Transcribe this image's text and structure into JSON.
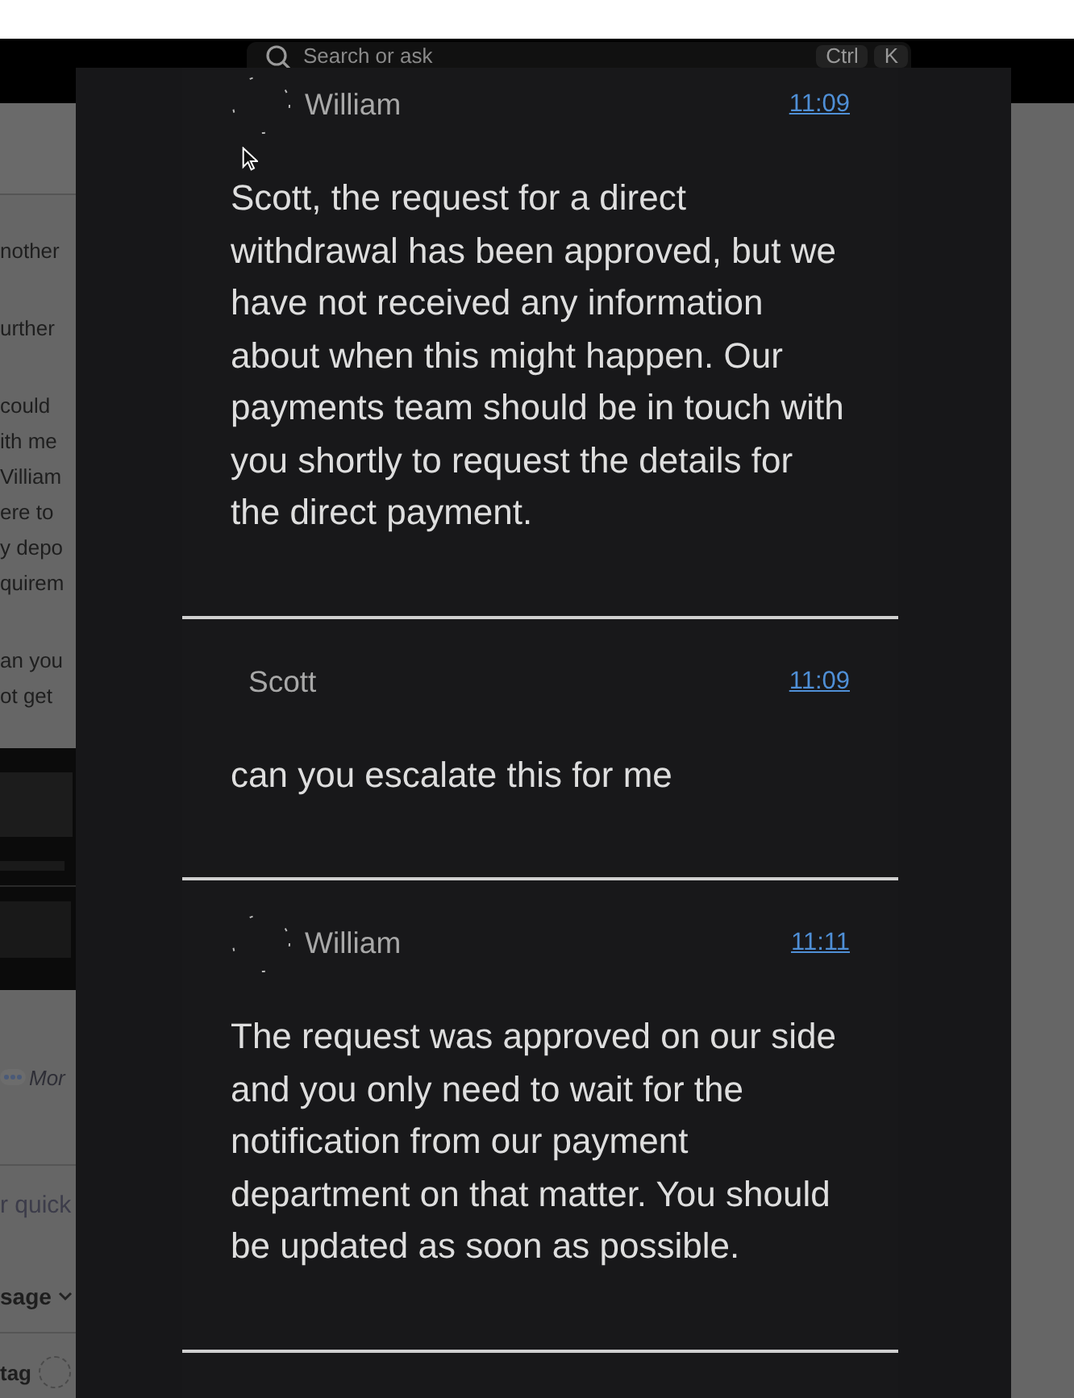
{
  "top_bar": {
    "search": {
      "placeholder": "Search or ask"
    },
    "shortcut_keys": [
      "Ctrl",
      "K"
    ]
  },
  "background_page": {
    "lines": [
      {
        "kind": "text",
        "text": "nother"
      },
      {
        "kind": "text",
        "text": "urther"
      },
      {
        "kind": "text",
        "text": "could"
      },
      {
        "kind": "text",
        "text": "ith me"
      },
      {
        "kind": "text",
        "text": "Villiam"
      },
      {
        "kind": "text",
        "text": "ere to"
      },
      {
        "kind": "text",
        "text": "y depo"
      },
      {
        "kind": "text",
        "text": "quirem"
      },
      {
        "kind": "text",
        "text": "an you"
      },
      {
        "kind": "text",
        "text": "ot get"
      },
      {
        "kind": "picture"
      },
      {
        "kind": "more",
        "text": "Mor"
      },
      {
        "kind": "hint",
        "text": "r quick"
      },
      {
        "kind": "dropdown",
        "text": "sage"
      },
      {
        "kind": "label",
        "text": "tag"
      }
    ]
  },
  "conversation": {
    "messages": [
      {
        "author": "William",
        "has_avatar": true,
        "time": "11:09",
        "text": "Scott, the request for a direct withdrawal has been approved, but we have not received any information about when this might happen. Our payments team should be in touch with you shortly to request the details for the direct payment."
      },
      {
        "author": "Scott",
        "has_avatar": false,
        "time": "11:09",
        "text": "can you escalate this for me"
      },
      {
        "author": "William",
        "has_avatar": true,
        "time": "11:11",
        "text": "The request was approved on our side and you only need to wait for the notification from our payment department on that matter. You should be updated as soon as possible."
      }
    ]
  }
}
